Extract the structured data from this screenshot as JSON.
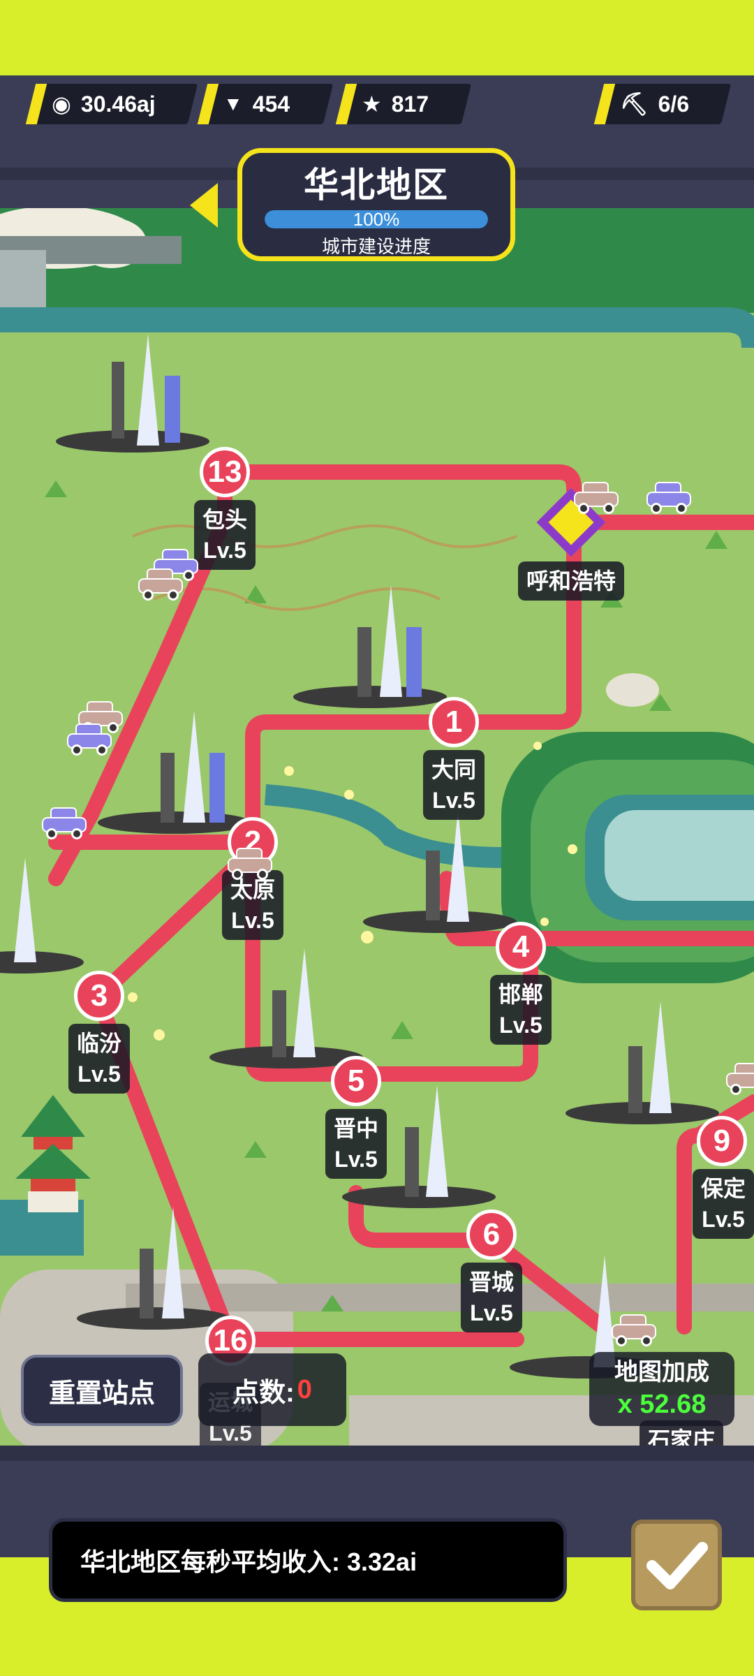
{
  "stats": {
    "coins": "30.46aj",
    "gems": "454",
    "stars": "817",
    "workers": "6/6"
  },
  "region": {
    "name": "华北地区",
    "progress_text": "100%",
    "progress_fraction": 1.0,
    "subtitle": "城市建设进度"
  },
  "stations": [
    {
      "num": "13",
      "name": "包头",
      "level": "Lv.5"
    },
    {
      "num": "",
      "name": "呼和浩特",
      "level": ""
    },
    {
      "num": "1",
      "name": "大同",
      "level": "Lv.5"
    },
    {
      "num": "2",
      "name": "太原",
      "level": "Lv.5"
    },
    {
      "num": "4",
      "name": "邯郸",
      "level": "Lv.5"
    },
    {
      "num": "3",
      "name": "临汾",
      "level": "Lv.5"
    },
    {
      "num": "5",
      "name": "晋中",
      "level": "Lv.5"
    },
    {
      "num": "9",
      "name": "保定",
      "level": "Lv.5"
    },
    {
      "num": "6",
      "name": "晋城",
      "level": "Lv.5"
    },
    {
      "num": "16",
      "name": "运城",
      "level": "Lv.5"
    },
    {
      "num": "",
      "name": "石家庄",
      "level": ""
    }
  ],
  "controls": {
    "reset": "重置站点",
    "points_label": "点数:",
    "points_value": "0",
    "bonus_label": "地图加成",
    "bonus_value": "x 52.68"
  },
  "income": {
    "text": "华北地区每秒平均收入: 3.32ai"
  },
  "colors": {
    "accent": "#f5e31c",
    "route": "#e8435a",
    "map_bg": "#9bc86a"
  }
}
